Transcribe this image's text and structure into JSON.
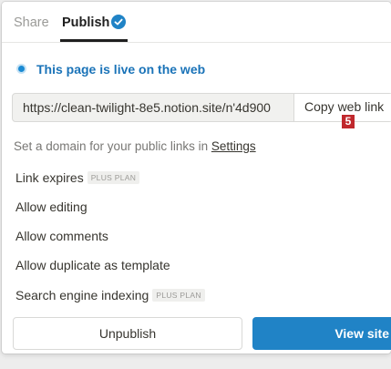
{
  "tabs": {
    "share_label": "Share",
    "publish_label": "Publish"
  },
  "status": {
    "live_text": "This page is live on the web"
  },
  "url": {
    "value": "https://clean-twilight-8e5.notion.site/n'4d900",
    "copy_label": "Copy web link"
  },
  "badge": "5",
  "domain": {
    "prefix": "Set a domain for your public links in ",
    "link_label": "Settings"
  },
  "options": {
    "link_expires": "Link expires",
    "link_expires_tag": "PLUS PLAN",
    "allow_editing": "Allow editing",
    "allow_comments": "Allow comments",
    "allow_duplicate": "Allow duplicate as template",
    "search_indexing": "Search engine indexing",
    "search_indexing_tag": "PLUS PLAN"
  },
  "actions": {
    "unpublish_label": "Unpublish",
    "view_site_label": "View site"
  },
  "colors": {
    "accent": "#2083c6",
    "live": "#1a73b8",
    "badge": "#c0282d"
  }
}
